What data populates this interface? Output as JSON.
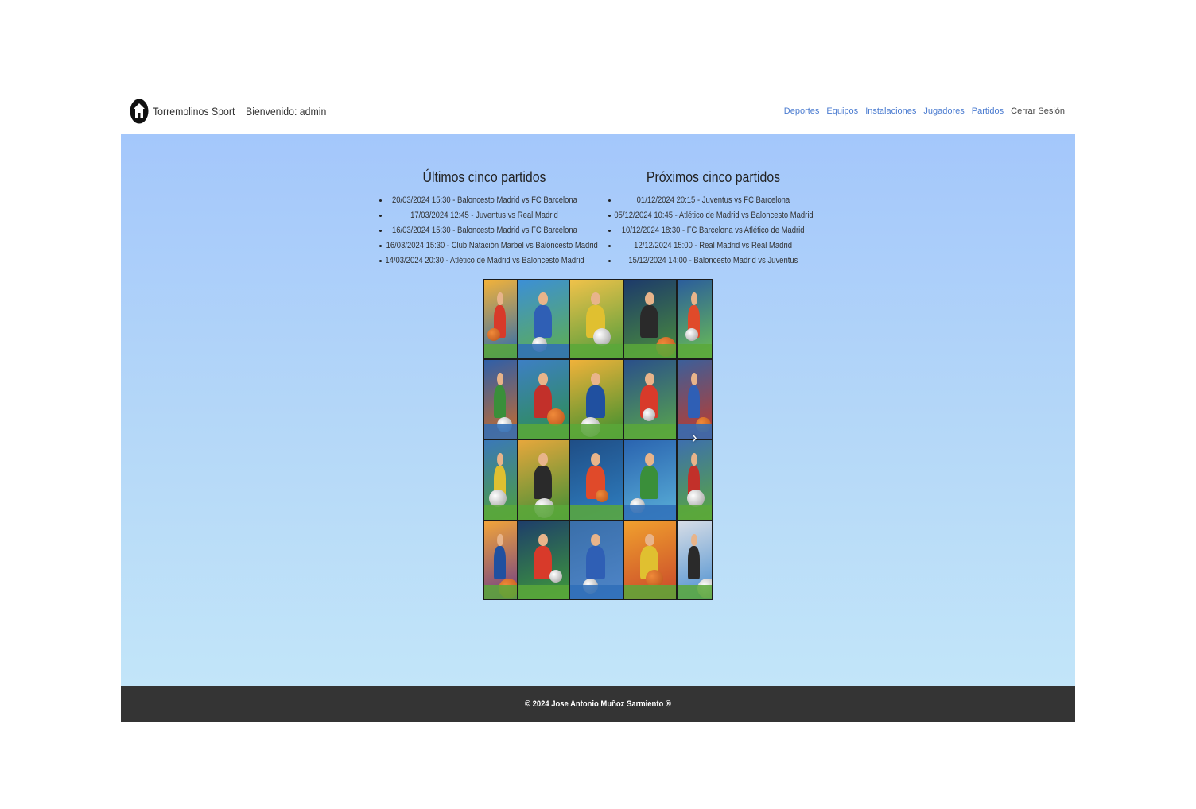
{
  "header": {
    "brand": "Torremolinos Sport",
    "welcome": "Bienvenido: admin",
    "logo_icon": "house-icon",
    "nav": [
      {
        "label": "Deportes"
      },
      {
        "label": "Equipos"
      },
      {
        "label": "Instalaciones"
      },
      {
        "label": "Jugadores"
      },
      {
        "label": "Partidos"
      },
      {
        "label": "Cerrar Sesión"
      }
    ]
  },
  "main": {
    "past": {
      "title": "Últimos cinco partidos",
      "items": [
        "20/03/2024 15:30 - Baloncesto Madrid vs FC Barcelona",
        "17/03/2024 12:45 - Juventus vs Real Madrid",
        "16/03/2024 15:30 - Baloncesto Madrid vs FC Barcelona",
        "16/03/2024 15:30 - Club Natación Marbel vs Baloncesto Madrid",
        "14/03/2024 20:30 - Atlético de Madrid vs Baloncesto Madrid"
      ]
    },
    "upcoming": {
      "title": "Próximos cinco partidos",
      "items": [
        "01/12/2024 20:15 - Juventus vs FC Barcelona",
        "05/12/2024 10:45 - Atlético de Madrid vs Baloncesto Madrid",
        "10/12/2024 18:30 - FC Barcelona vs Atlético de Madrid",
        "12/12/2024 15:00 - Real Madrid vs Real Madrid",
        "15/12/2024 14:00 - Baloncesto Madrid vs Juventus"
      ]
    },
    "carousel": {
      "next_icon": "chevron-right-icon",
      "image_subject": "sports-collage-image"
    }
  },
  "footer": {
    "text": "© 2024 Jose Antonio Muñoz Sarmiento ®"
  },
  "colors": {
    "nav_link": "#4a7bd0",
    "hero_top": "#a4c7fb",
    "hero_bottom": "#c2e5f9",
    "footer_bg": "#343434"
  }
}
